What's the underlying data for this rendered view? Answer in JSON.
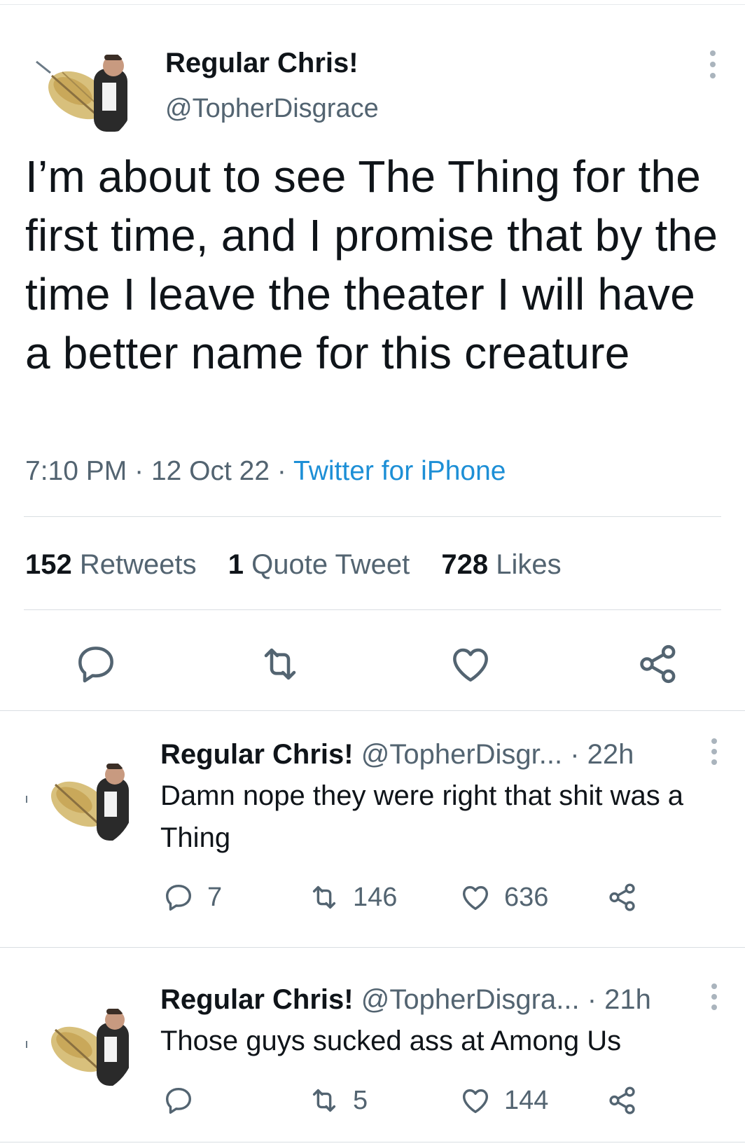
{
  "main_tweet": {
    "name": "Regular Chris!",
    "handle": "@TopherDisgrace",
    "text": "I’m about to see The Thing for the first time, and I promise that by the time I leave the theater I will have a better name for this creature",
    "time": "7:10 PM",
    "date": "12 Oct 22",
    "separator": "·",
    "source": "Twitter for iPhone",
    "stats": {
      "retweets_count": "152",
      "retweets_label": "Retweets",
      "quotes_count": "1",
      "quotes_label": "Quote Tweet",
      "likes_count": "728",
      "likes_label": "Likes"
    }
  },
  "replies": [
    {
      "name": "Regular Chris!",
      "handle": "@TopherDisgr...",
      "time": "· 22h",
      "text": "Damn nope they were right that shit was a Thing",
      "replies": "7",
      "retweets": "146",
      "likes": "636"
    },
    {
      "name": "Regular Chris!",
      "handle": "@TopherDisgra...",
      "time": "· 21h",
      "text": "Those guys sucked ass at Among Us",
      "replies": "",
      "retweets": "5",
      "likes": "144"
    }
  ],
  "colors": {
    "text": "#0f1419",
    "secondary": "#536471",
    "link": "#1d9bf0",
    "divider": "#d9dee2"
  },
  "icons": [
    "reply-icon",
    "retweet-icon",
    "like-icon",
    "share-icon",
    "more-icon"
  ]
}
